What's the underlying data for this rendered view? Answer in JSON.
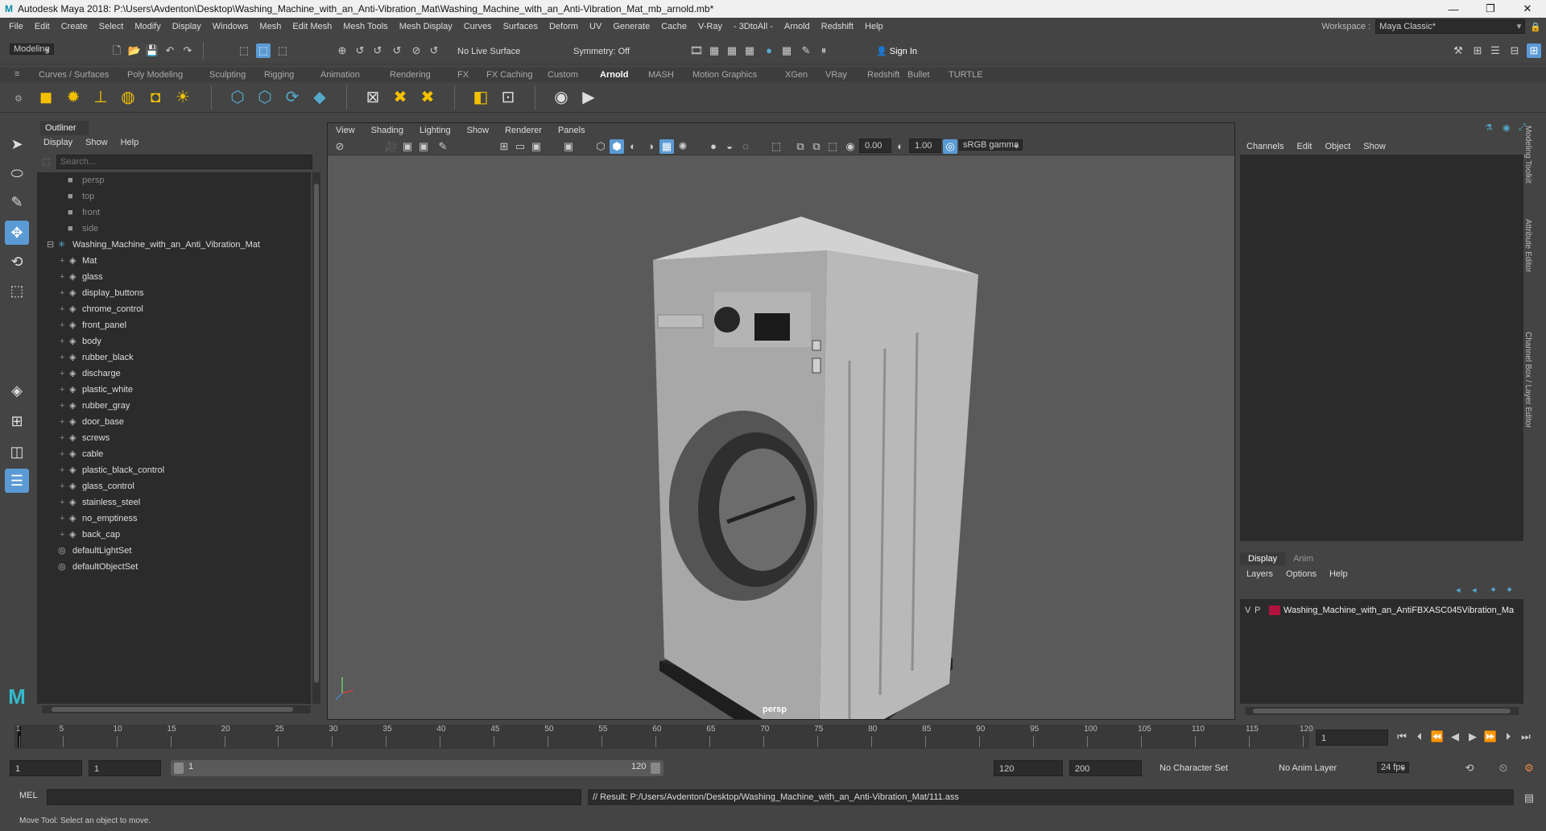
{
  "window": {
    "title": "Autodesk Maya 2018: P:\\Users\\Avdenton\\Desktop\\Washing_Machine_with_an_Anti-Vibration_Mat\\Washing_Machine_with_an_Anti-Vibration_Mat_mb_arnold.mb*",
    "logo": "M",
    "minimize": "—",
    "maximize": "❐",
    "close": "✕"
  },
  "menubar": {
    "items": [
      "File",
      "Edit",
      "Create",
      "Select",
      "Modify",
      "Display",
      "Windows",
      "Mesh",
      "Edit Mesh",
      "Mesh Tools",
      "Mesh Display",
      "Curves",
      "Surfaces",
      "Deform",
      "UV",
      "Generate",
      "Cache",
      "V-Ray",
      "- 3DtoAll -",
      "Arnold",
      "Redshift",
      "Help"
    ],
    "workspace_label": "Workspace :",
    "workspace_value": "Maya Classic*"
  },
  "statusline": {
    "mode": "Modeling",
    "live_surface": "No Live Surface",
    "symmetry": "Symmetry: Off",
    "sign_in": "Sign In"
  },
  "shelf": {
    "tabs": [
      "Curves / Surfaces",
      "Poly Modeling",
      "Sculpting",
      "Rigging",
      "Animation",
      "Rendering",
      "FX",
      "FX Caching",
      "Custom",
      "Arnold",
      "MASH",
      "Motion Graphics",
      "XGen",
      "VRay",
      "Redshift",
      "Bullet",
      "TURTLE"
    ],
    "active_tab": "Arnold"
  },
  "outliner": {
    "title": "Outliner",
    "menu": [
      "Display",
      "Show",
      "Help"
    ],
    "search_placeholder": "Search...",
    "cameras": [
      "persp",
      "top",
      "front",
      "side"
    ],
    "group": "Washing_Machine_with_an_Anti_Vibration_Mat",
    "children": [
      "Mat",
      "glass",
      "display_buttons",
      "chrome_control",
      "front_panel",
      "body",
      "rubber_black",
      "discharge",
      "plastic_white",
      "rubber_gray",
      "door_base",
      "screws",
      "cable",
      "plastic_black_control",
      "glass_control",
      "stainless_steel",
      "no_emptiness",
      "back_cap"
    ],
    "sets": [
      "defaultLightSet",
      "defaultObjectSet"
    ]
  },
  "viewport": {
    "menu": [
      "View",
      "Shading",
      "Lighting",
      "Show",
      "Renderer",
      "Panels"
    ],
    "near": "0.00",
    "gamma_val": "1.00",
    "color_space": "sRGB gamma",
    "camera_label": "persp"
  },
  "channel_box": {
    "menu": [
      "Channels",
      "Edit",
      "Object",
      "Show"
    ],
    "side_tabs": [
      "Modeling Toolkit",
      "Attribute Editor",
      "Channel Box / Layer Editor"
    ]
  },
  "layer_editor": {
    "tabs": [
      "Display",
      "Anim"
    ],
    "menu": [
      "Layers",
      "Options",
      "Help"
    ],
    "layer_v": "V",
    "layer_p": "P",
    "layer_name": "Washing_Machine_with_an_AntiFBXASC045Vibration_Ma",
    "layer_color": "#b0143c"
  },
  "timeline": {
    "ticks": [
      "1",
      "5",
      "10",
      "15",
      "20",
      "25",
      "30",
      "35",
      "40",
      "45",
      "50",
      "55",
      "60",
      "65",
      "70",
      "75",
      "80",
      "85",
      "90",
      "95",
      "100",
      "105",
      "110",
      "115",
      "120"
    ],
    "current_frame": "1"
  },
  "range": {
    "start": "1",
    "anim_start": "1",
    "slider_start": "1",
    "slider_end": "120",
    "anim_end": "120",
    "end": "200",
    "character_set": "No Character Set",
    "anim_layer": "No Anim Layer",
    "fps": "24 fps"
  },
  "cmdline": {
    "label": "MEL",
    "result": "// Result: P:/Users/Avdenton/Desktop/Washing_Machine_with_an_Anti-Vibration_Mat/111.ass"
  },
  "helpline": {
    "text": "Move Tool: Select an object to move."
  },
  "colors": {
    "accent": "#5b9bd5",
    "bg": "#444444",
    "viewport": "#5a5a5a",
    "layer": "#b0143c"
  }
}
